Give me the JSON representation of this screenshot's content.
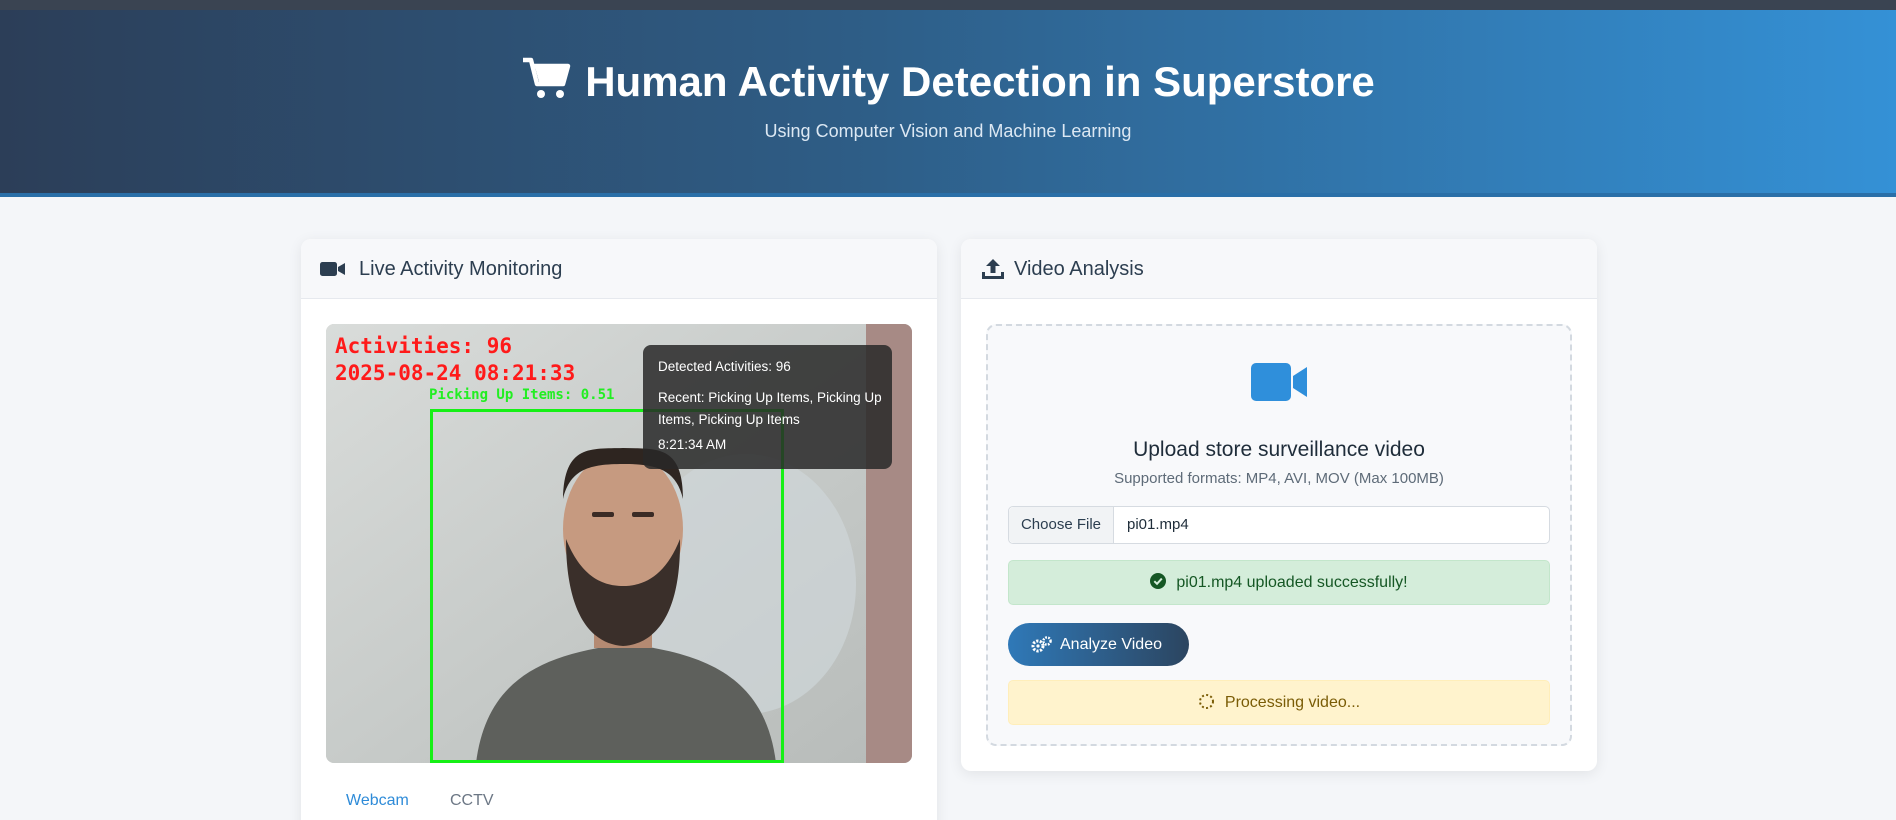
{
  "header": {
    "title": "Human Activity Detection in Superstore",
    "subtitle": "Using Computer Vision and Machine Learning",
    "icon": "shopping-cart-icon"
  },
  "live": {
    "title": "Live Activity Monitoring",
    "icon": "video-camera-icon",
    "overlay": {
      "activities": "Activities: 96",
      "timestamp": "2025-08-24 08:21:33",
      "detection_label": "Picking Up Items: 0.51"
    },
    "tooltip": {
      "detected": "Detected Activities: 96",
      "recent": "Recent: Picking Up Items, Picking Up Items, Picking Up Items",
      "time": "8:21:34 AM"
    },
    "tabs": [
      {
        "label": "Webcam",
        "active": true
      },
      {
        "label": "CCTV",
        "active": false
      }
    ]
  },
  "video": {
    "title": "Video Analysis",
    "icon": "upload-icon",
    "upload_title": "Upload store surveillance video",
    "formats": "Supported formats: MP4, AVI, MOV (Max 100MB)",
    "choose_file_label": "Choose File",
    "file_name": "pi01.mp4",
    "success_message": "pi01.mp4 uploaded successfully!",
    "analyze_label": "Analyze Video",
    "processing_message": "Processing video..."
  },
  "colors": {
    "accent": "#2e8bd8",
    "success_bg": "#d4edda",
    "warning_bg": "#fff3cd",
    "detection_box": "#16f016",
    "overlay_text": "#ff1a1a"
  }
}
